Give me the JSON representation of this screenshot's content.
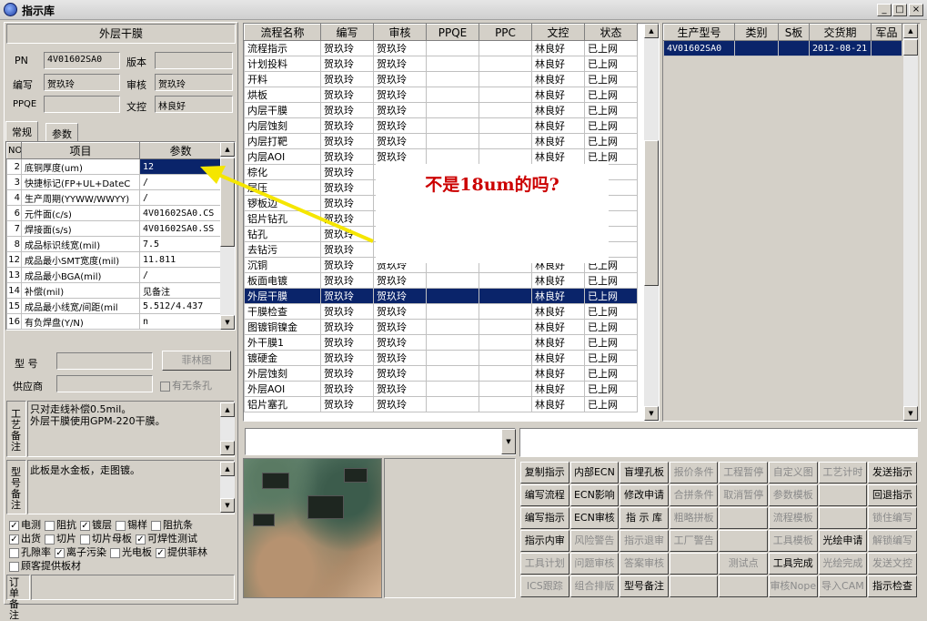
{
  "window": {
    "title": "指示库",
    "min": "_",
    "max": "□",
    "close": "×"
  },
  "left": {
    "section_title": "外层干膜",
    "pn_label": "PN",
    "pn_value": "4V01602SA0",
    "version_label": "版本",
    "version_value": "",
    "author_label": "编写",
    "author_value": "贺玖玲",
    "review_label": "审核",
    "review_value": "贺玖玲",
    "ppqe_label": "PPQE",
    "ppqe_value": "",
    "doc_label": "文控",
    "doc_value": "林良好",
    "tabs": [
      {
        "label": "常规"
      },
      {
        "label": "参数"
      }
    ],
    "param_headers": [
      "NO",
      "项目",
      "参数"
    ],
    "params": [
      {
        "no": "2",
        "item": "底铜厚度(um)",
        "value": "12"
      },
      {
        "no": "3",
        "item": "快捷标记(FP+UL+DateC",
        "value": "/"
      },
      {
        "no": "4",
        "item": "生产周期(YYWW/WWYY)",
        "value": "/"
      },
      {
        "no": "6",
        "item": "元件面(c/s)",
        "value": "4V01602SA0.CS"
      },
      {
        "no": "7",
        "item": "焊接面(s/s)",
        "value": "4V01602SA0.SS"
      },
      {
        "no": "8",
        "item": "成品标识线宽(mil)",
        "value": "7.5"
      },
      {
        "no": "12",
        "item": "成品最小SMT宽度(mil)",
        "value": "11.811"
      },
      {
        "no": "13",
        "item": "成品最小BGA(mil)",
        "value": "/"
      },
      {
        "no": "14",
        "item": "补偿(mil)",
        "value": "见备注"
      },
      {
        "no": "15",
        "item": "成品最小线宽/间距(mil",
        "value": "5.512/4.437"
      },
      {
        "no": "16",
        "item": "有负焊盘(Y/N)",
        "value": "n"
      }
    ],
    "model_label": "型 号",
    "model_value": "",
    "film_button": "菲林图",
    "supplier_label": "供应商",
    "supplier_value": "",
    "has_barcode_label": "有无条孔",
    "process_note_label": "工艺备注",
    "process_note": "只对走线补偿0.5mil。\n外层干膜使用GPM-220干膜。",
    "model_note_label": "型号备注",
    "model_note": "此板是水金板，走图镀。",
    "checkboxes": [
      [
        {
          "label": "电测",
          "checked": true
        },
        {
          "label": "阻抗",
          "checked": false
        },
        {
          "label": "镀层",
          "checked": true
        },
        {
          "label": "锡样",
          "checked": false
        },
        {
          "label": "阻抗条",
          "checked": false
        }
      ],
      [
        {
          "label": "出货",
          "checked": true
        },
        {
          "label": "切片",
          "checked": false
        },
        {
          "label": "切片母板",
          "checked": false
        },
        {
          "label": "可焊性测试",
          "checked": true
        }
      ],
      [
        {
          "label": "孔隙率",
          "checked": false
        },
        {
          "label": "离子污染",
          "checked": true
        },
        {
          "label": "光电板",
          "checked": false
        },
        {
          "label": "提供菲林",
          "checked": true
        }
      ],
      [
        {
          "label": "顾客提供板材",
          "checked": false
        }
      ]
    ],
    "order_note_label": "订单备注",
    "order_note": ""
  },
  "process": {
    "headers": [
      "流程名称",
      "编写",
      "审核",
      "PPQE",
      "PPC",
      "文控",
      "状态"
    ],
    "rows": [
      [
        "流程指示",
        "贺玖玲",
        "贺玖玲",
        "",
        "",
        "林良好",
        "已上网"
      ],
      [
        "计划投料",
        "贺玖玲",
        "贺玖玲",
        "",
        "",
        "林良好",
        "已上网"
      ],
      [
        "开料",
        "贺玖玲",
        "贺玖玲",
        "",
        "",
        "林良好",
        "已上网"
      ],
      [
        "烘板",
        "贺玖玲",
        "贺玖玲",
        "",
        "",
        "林良好",
        "已上网"
      ],
      [
        "内层干膜",
        "贺玖玲",
        "贺玖玲",
        "",
        "",
        "林良好",
        "已上网"
      ],
      [
        "内层蚀刻",
        "贺玖玲",
        "贺玖玲",
        "",
        "",
        "林良好",
        "已上网"
      ],
      [
        "内层打靶",
        "贺玖玲",
        "贺玖玲",
        "",
        "",
        "林良好",
        "已上网"
      ],
      [
        "内层AOI",
        "贺玖玲",
        "贺玖玲",
        "",
        "",
        "林良好",
        "已上网"
      ],
      [
        "棕化",
        "贺玖玲",
        "",
        "",
        "",
        "",
        "网"
      ],
      [
        "层压",
        "贺玖玲",
        "",
        "",
        "",
        "",
        "网"
      ],
      [
        "锣板边",
        "贺玖玲",
        "",
        "",
        "",
        "",
        "网"
      ],
      [
        "铝片钻孔",
        "贺玖玲",
        "",
        "",
        "",
        "",
        "网"
      ],
      [
        "钻孔",
        "贺玖玲",
        "",
        "",
        "",
        "",
        "网"
      ],
      [
        "去钻污",
        "贺玖玲",
        "",
        "",
        "",
        "",
        "网"
      ],
      [
        "沉铜",
        "贺玖玲",
        "贺玖玲",
        "",
        "",
        "林良好",
        "已上网"
      ],
      [
        "板面电镀",
        "贺玖玲",
        "贺玖玲",
        "",
        "",
        "林良好",
        "已上网"
      ],
      [
        "外层干膜",
        "贺玖玲",
        "贺玖玲",
        "",
        "",
        "林良好",
        "已上网"
      ],
      [
        "干膜检查",
        "贺玖玲",
        "贺玖玲",
        "",
        "",
        "林良好",
        "已上网"
      ],
      [
        "图镀铜镍金",
        "贺玖玲",
        "贺玖玲",
        "",
        "",
        "林良好",
        "已上网"
      ],
      [
        "外干膜1",
        "贺玖玲",
        "贺玖玲",
        "",
        "",
        "林良好",
        "已上网"
      ],
      [
        "镀硬金",
        "贺玖玲",
        "贺玖玲",
        "",
        "",
        "林良好",
        "已上网"
      ],
      [
        "外层蚀刻",
        "贺玖玲",
        "贺玖玲",
        "",
        "",
        "林良好",
        "已上网"
      ],
      [
        "外层AOI",
        "贺玖玲",
        "贺玖玲",
        "",
        "",
        "林良好",
        "已上网"
      ],
      [
        "铝片塞孔",
        "贺玖玲",
        "贺玖玲",
        "",
        "",
        "林良好",
        "已上网"
      ]
    ],
    "selected_index": 16
  },
  "annotation": {
    "text": "不是18um的吗?",
    "color": "#cc0000"
  },
  "orders": {
    "headers": [
      "生产型号",
      "类别",
      "S板",
      "交货期",
      "军品"
    ],
    "rows": [
      [
        "4V01602SA0",
        "",
        "",
        "2012-08-21",
        ""
      ]
    ]
  },
  "buttons": [
    [
      {
        "label": "复制指示",
        "enabled": true
      },
      {
        "label": "内部ECN",
        "enabled": true
      },
      {
        "label": "盲埋孔板",
        "enabled": true
      },
      {
        "label": "报价条件",
        "enabled": false
      },
      {
        "label": "工程暂停",
        "enabled": false
      },
      {
        "label": "自定义图",
        "enabled": false
      },
      {
        "label": "工艺计时",
        "enabled": false
      },
      {
        "label": "发送指示",
        "enabled": true
      }
    ],
    [
      {
        "label": "编写流程",
        "enabled": true
      },
      {
        "label": "ECN影响",
        "enabled": true
      },
      {
        "label": "修改申请",
        "enabled": true
      },
      {
        "label": "合拼条件",
        "enabled": false
      },
      {
        "label": "取消暂停",
        "enabled": false
      },
      {
        "label": "参数模板",
        "enabled": false
      },
      {
        "label": "",
        "enabled": false
      },
      {
        "label": "回退指示",
        "enabled": true
      }
    ],
    [
      {
        "label": "编写指示",
        "enabled": true
      },
      {
        "label": "ECN审核",
        "enabled": true
      },
      {
        "label": "指 示 库",
        "enabled": true
      },
      {
        "label": "粗略拼板",
        "enabled": false
      },
      {
        "label": "",
        "enabled": false
      },
      {
        "label": "流程模板",
        "enabled": false
      },
      {
        "label": "",
        "enabled": false
      },
      {
        "label": "锁住编写",
        "enabled": false
      }
    ],
    [
      {
        "label": "指示内审",
        "enabled": true
      },
      {
        "label": "风险警告",
        "enabled": false
      },
      {
        "label": "指示退审",
        "enabled": false
      },
      {
        "label": "工厂警告",
        "enabled": false
      },
      {
        "label": "",
        "enabled": false
      },
      {
        "label": "工具模板",
        "enabled": false
      },
      {
        "label": "光绘申请",
        "enabled": true
      },
      {
        "label": "解锁编写",
        "enabled": false
      }
    ],
    [
      {
        "label": "工具计划",
        "enabled": false
      },
      {
        "label": "问题审核",
        "enabled": false
      },
      {
        "label": "答案审核",
        "enabled": false
      },
      {
        "label": "",
        "enabled": false
      },
      {
        "label": "测试点",
        "enabled": false
      },
      {
        "label": "工具完成",
        "enabled": true
      },
      {
        "label": "光绘完成",
        "enabled": false
      },
      {
        "label": "发送文控",
        "enabled": false
      }
    ],
    [
      {
        "label": "ICS跟踪",
        "enabled": false
      },
      {
        "label": "组合排版",
        "enabled": false
      },
      {
        "label": "型号备注",
        "enabled": true
      },
      {
        "label": "",
        "enabled": false
      },
      {
        "label": "",
        "enabled": false
      },
      {
        "label": "审核Nope",
        "enabled": false
      },
      {
        "label": "导入CAM",
        "enabled": false
      },
      {
        "label": "指示检查",
        "enabled": true
      }
    ]
  ]
}
